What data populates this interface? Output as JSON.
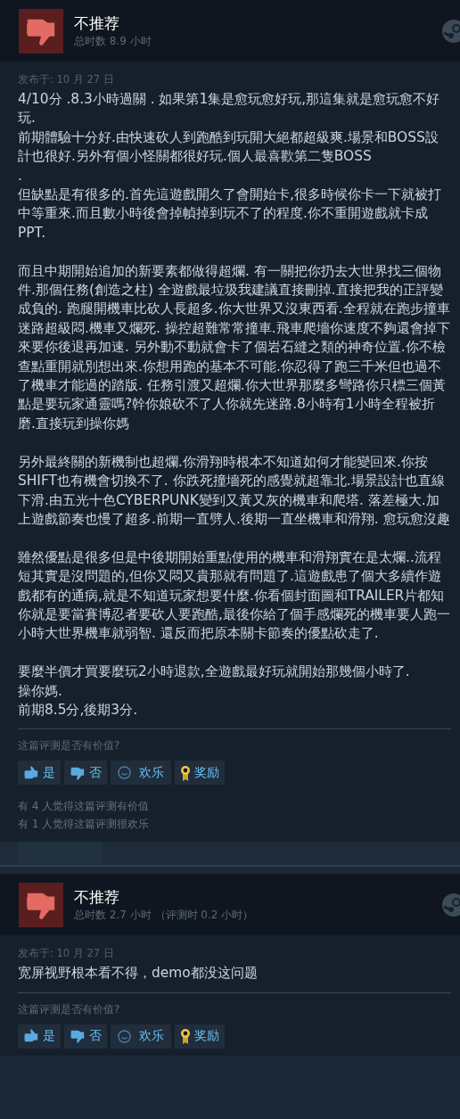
{
  "reviews": [
    {
      "verdict": "不推荐",
      "recommended": false,
      "hours": "总时数 8.9 小时",
      "posted": "发布于: 10 月 27 日",
      "paragraphs": [
        [
          "4/10分 .8.3小時過關 . 如果第1集是愈玩愈好玩,那這集就是愈玩愈不好玩.",
          "前期體驗十分好.由快速砍人到跑酷到玩開大絕都超級爽.場景和BOSS設計也很好.另外有個小怪關都很好玩.個人最喜歡第二隻BOSS",
          ".",
          "但缺點是有很多的.首先這遊戲開久了會開始卡,很多時候你卡一下就被打中等重來.而且數小時後會掉幀掉到玩不了的程度.你不重開遊戲就卡成PPT."
        ],
        [
          "而且中期開始追加的新要素都做得超爛. 有一關把你扔去大世界找三個物件.那個任務(創造之柱) 全遊戲最垃圾我建議直接刪掉.直接把我的正評變成負的. 跑腿開機車比砍人長超多.你大世界又沒東西看.全程就在跑步撞車迷路超級悶.機車又爛死. 操控超難常常撞車.飛車爬墻你速度不夠還會掉下來要你後退再加速. 另外動不動就會卡了個岩石縫之類的神奇位置.你不檢查點重開就別想出來.你想用跑的基本不可能.你忍得了跑三千米但也過不了機車才能過的踏版. 任務引渡又超爛.你大世界那麼多彎路你只標三個黃點是要玩家通靈嗎?幹你娘砍不了人你就先迷路.8小時有1小時全程被折磨.直接玩到操你媽"
        ],
        [
          "另外最終關的新機制也超爛.你滑翔時根本不知道如何才能變回來.你按SHIFT也有機會切換不了. 你跌死撞墻死的感覺就超靠北.場景設計也直線下滑.由五光十色CYBERPUNK變到又黃又灰的機車和爬塔. 落差極大.加上遊戲節奏也慢了超多.前期一直劈人.後期一直坐機車和滑翔. 愈玩愈沒趣"
        ],
        [
          "雖然優點是很多但是中後期開始重點使用的機車和滑翔實在是太爛..流程短其實是沒問題的,但你又悶又貴那就有問題了.這遊戲患了個大多續作遊戲都有的通病,就是不知道玩家想要什麼.你看個封面圖和TRAILER片都知你就是要當賽博忍者要砍人要跑酷,最後你給了個手感爛死的機車要人跑一小時大世界機車就弱智. 還反而把原本關卡節奏的優點砍走了."
        ],
        [
          "要麼半價才買要麼玩2小時退款,全遊戲最好玩就開始那幾個小時了.",
          "操你媽.",
          "前期8.5分,後期3分."
        ]
      ],
      "question": "这篇评测是否有价值?",
      "buttons": [
        {
          "kind": "thumbs-up",
          "label": "是"
        },
        {
          "kind": "thumbs-down",
          "label": "否"
        },
        {
          "kind": "funny",
          "label": "欢乐"
        },
        {
          "kind": "award",
          "label": "奖励"
        }
      ],
      "counts": [
        "有 4 人觉得这篇评测有价值",
        "有 1 人觉得这篇评测很欢乐"
      ],
      "comment_bar": true
    },
    {
      "verdict": "不推荐",
      "recommended": false,
      "hours": "总时数 2.7 小时 （评测时 0.2 小时）",
      "posted": "发布于: 10 月 27 日",
      "paragraphs": [
        [
          "宽屏视野根本看不得，demo都没这问题"
        ]
      ],
      "question": "这篇评测是否有价值?",
      "buttons": [
        {
          "kind": "thumbs-up",
          "label": "是"
        },
        {
          "kind": "thumbs-down",
          "label": "否"
        },
        {
          "kind": "funny",
          "label": "欢乐"
        },
        {
          "kind": "award",
          "label": "奖励"
        }
      ]
    }
  ]
}
